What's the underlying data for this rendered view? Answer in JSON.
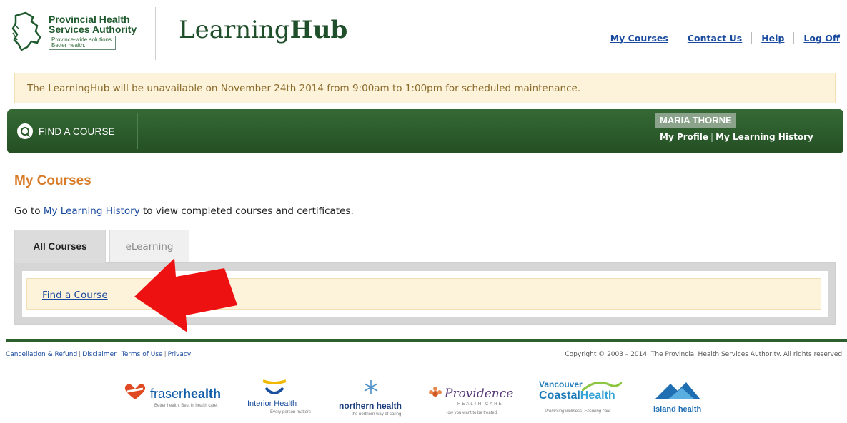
{
  "header": {
    "phsa_logo": {
      "name_line1": "Provincial Health",
      "name_line2": "Services Authority",
      "tagline_line1": "Province-wide solutions.",
      "tagline_line2": "Better health."
    },
    "brand_light": "Learning",
    "brand_bold": "Hub",
    "nav": {
      "my_courses": "My Courses",
      "contact_us": "Contact Us",
      "help": "Help",
      "log_off": "Log Off"
    }
  },
  "alert": {
    "text": "The LearningHub will be unavailable on November 24th 2014 from 9:00am to 1:00pm for scheduled maintenance."
  },
  "navbar": {
    "find_course": "FIND A COURSE",
    "user_name": "MARIA THORNE",
    "my_profile": "My Profile",
    "separator": "|",
    "my_learning_history": "My Learning History"
  },
  "main": {
    "title": "My Courses",
    "intro_prefix": "Go to ",
    "intro_link": "My Learning History",
    "intro_suffix": " to view completed courses and certificates.",
    "tabs": [
      {
        "label": "All Courses",
        "active": true
      },
      {
        "label": "eLearning",
        "active": false
      }
    ],
    "find_course_link": "Find a Course"
  },
  "footer": {
    "links": [
      "Cancellation & Refund",
      "Disclaimer",
      "Terms of Use",
      "Privacy"
    ],
    "copyright": "Copyright © 2003 – 2014. The Provincial Health Services Authority. All rights reserved.",
    "partners": {
      "fraser": {
        "name_a": "fraser",
        "name_b": "health",
        "tagline": "Better health. Best in health care."
      },
      "interior": {
        "name": "Interior Health",
        "tagline": "Every person matters"
      },
      "northern": {
        "name": "northern health",
        "tagline": "the northern way of caring"
      },
      "providence": {
        "name": "Providence",
        "sub": "HEALTH CARE",
        "tagline": "How you want to be treated."
      },
      "vch": {
        "name_a": "Vancouver",
        "name_b": "Coastal",
        "name_c": "Health",
        "tagline": "Promoting wellness. Ensuring care."
      },
      "island": {
        "name": "island health"
      }
    }
  },
  "colors": {
    "nav_green": "#2d5f2d",
    "link_blue": "#1a4a9e",
    "title_orange": "#d87c2a",
    "alert_bg": "#fdf3da",
    "arrow_red": "#ee1111"
  }
}
